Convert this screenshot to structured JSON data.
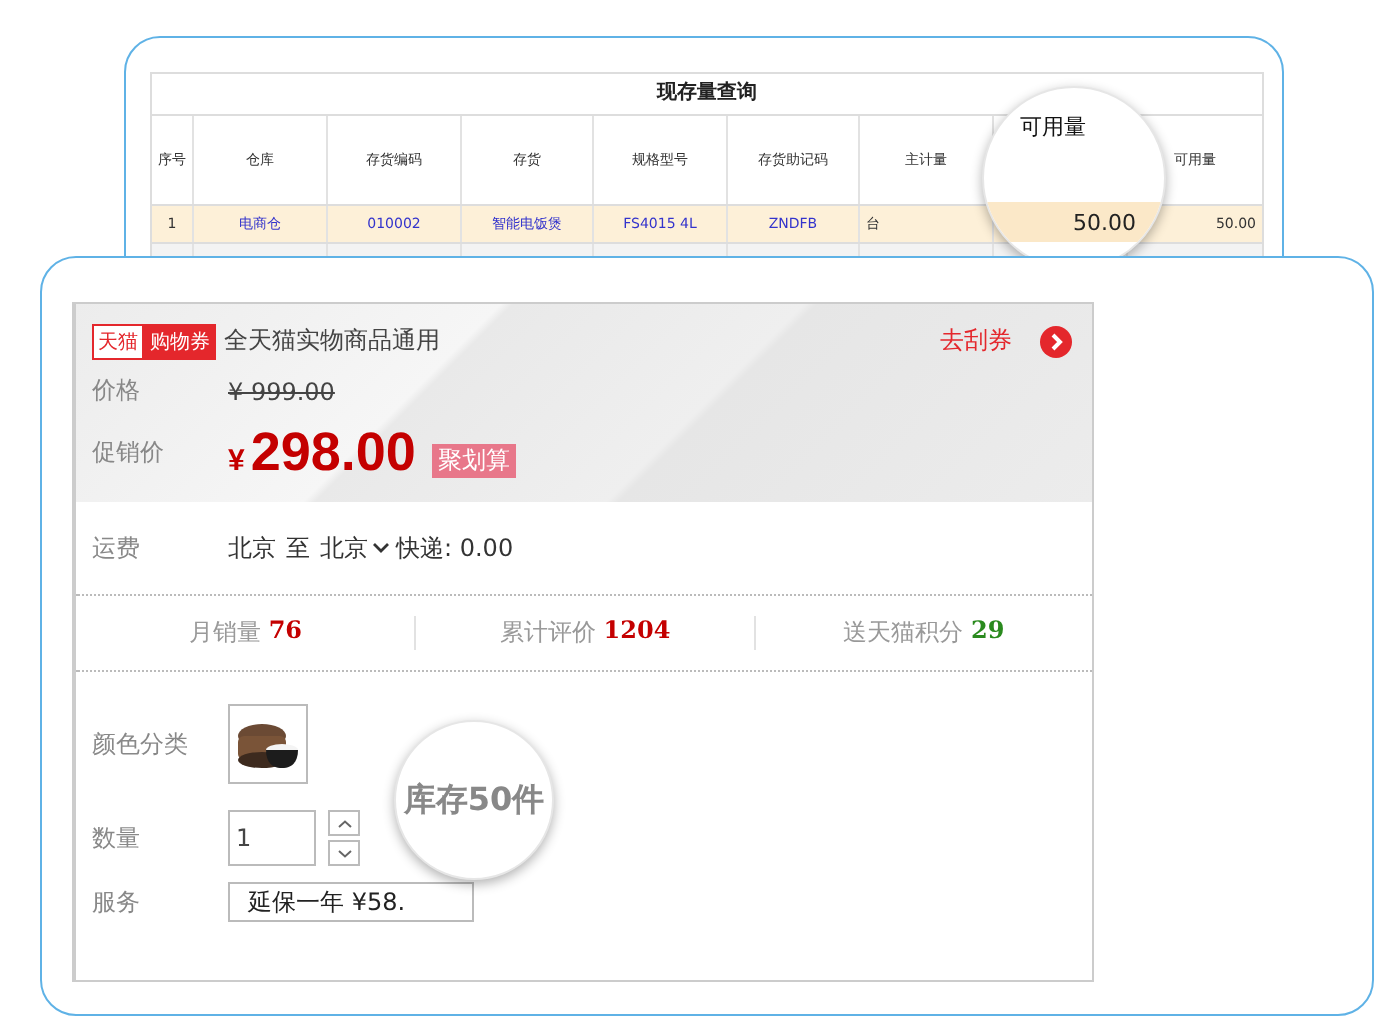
{
  "inventory_window": {
    "title": "现存量查询",
    "columns": [
      "序号",
      "仓库",
      "存货编码",
      "存货",
      "规格型号",
      "存货助记码",
      "主计量",
      "可用量"
    ],
    "rows": [
      {
        "cells": [
          "1",
          "电商仓",
          "010002",
          "智能电饭煲",
          "FS4015 4L",
          "ZNDFB",
          "台",
          "50.00"
        ]
      }
    ],
    "magnifier": {
      "label": "可用量",
      "value": "50.00"
    }
  },
  "product": {
    "coupon": {
      "brand": "天猫",
      "tag": "购物券",
      "text": "全天猫实物商品通用",
      "link": "去刮券"
    },
    "price": {
      "label": "价格",
      "currency": "¥",
      "amount": "999.00"
    },
    "promo": {
      "label": "促销价",
      "currency": "¥",
      "amount": "298.00",
      "badge": "聚划算"
    },
    "shipping": {
      "label": "运费",
      "from": "北京",
      "to_word": "至",
      "to": "北京",
      "method": "快递: 0.00"
    },
    "stats": [
      {
        "label": "月销量",
        "value": "76",
        "color": "#c40000"
      },
      {
        "label": "累计评价",
        "value": "1204",
        "color": "#c40000"
      },
      {
        "label": "送天猫积分",
        "value": "29",
        "color": "#2a8a1e"
      }
    ],
    "color_option": {
      "label": "颜色分类"
    },
    "quantity": {
      "label": "数量",
      "value": "1"
    },
    "stock_magnifier": {
      "text": "库存50件"
    },
    "service": {
      "label": "服务",
      "value": "延保一年 ¥58."
    }
  }
}
